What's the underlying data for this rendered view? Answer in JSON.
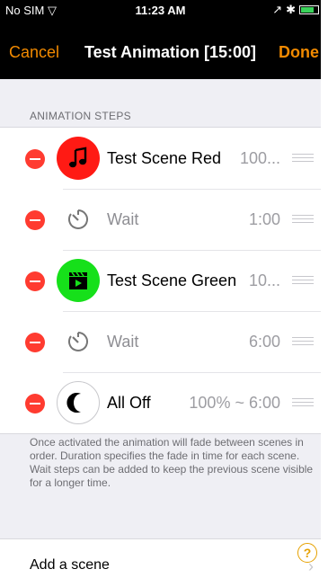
{
  "status_bar": {
    "carrier": "No SIM",
    "time": "11:23 AM"
  },
  "nav": {
    "cancel_label": "Cancel",
    "title": "Test Animation [15:00]",
    "done_label": "Done"
  },
  "section": {
    "header": "ANIMATION STEPS"
  },
  "steps": [
    {
      "label": "Test Scene Red",
      "detail": "100...",
      "icon": "music-note-icon",
      "icon_color": "#ff1a14"
    },
    {
      "label": "Wait",
      "detail": "1:00",
      "icon": "timer-icon"
    },
    {
      "label": "Test Scene Green",
      "detail": "10...",
      "icon": "clapperboard-icon",
      "icon_color": "#16e01a"
    },
    {
      "label": "Wait",
      "detail": "6:00",
      "icon": "timer-icon"
    },
    {
      "label": "All Off",
      "detail": "100% ~ 6:00",
      "icon": "moon-icon",
      "icon_color": "#ffffff"
    }
  ],
  "footer_note": "Once activated the animation will fade between scenes in order. Duration specifies the fade in time for each scene. Wait steps can be added to keep the previous scene visible for a longer time.",
  "add_scene": {
    "label": "Add a scene",
    "help_glyph": "?"
  },
  "colors": {
    "accent": "#f28a00",
    "delete": "#ff3b30"
  }
}
